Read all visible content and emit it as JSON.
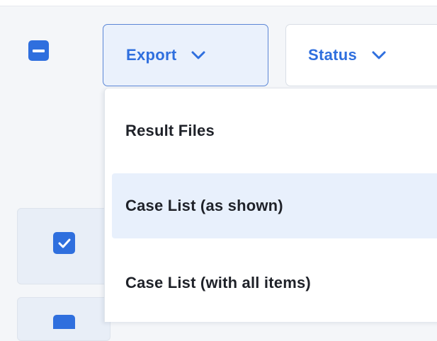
{
  "toolbar": {
    "export_label": "Export",
    "status_label": "Status"
  },
  "export_menu": {
    "items": [
      {
        "label": "Result Files",
        "highlighted": false
      },
      {
        "label": "Case List (as shown)",
        "highlighted": true
      },
      {
        "label": "Case List (with all items)",
        "highlighted": false
      }
    ]
  },
  "colors": {
    "accent": "#2f6fde",
    "highlight": "#e8f0fc",
    "text": "#1f2229"
  },
  "icons": {
    "select_all": "minus-checkbox-icon",
    "dropdown": "chevron-down-icon",
    "row_check": "check-icon"
  }
}
